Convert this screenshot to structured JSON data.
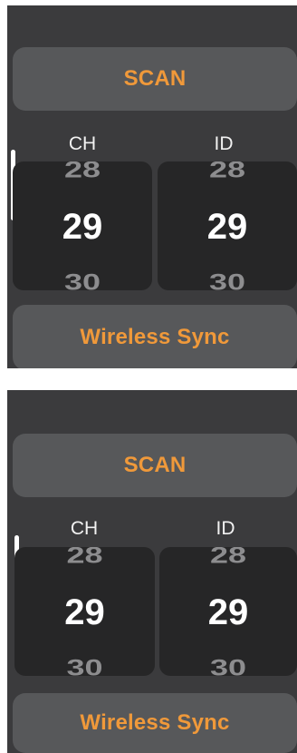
{
  "panels": [
    {
      "scan_label": "SCAN",
      "ch_label": "CH",
      "id_label": "ID",
      "ch": {
        "prev": "28",
        "current": "29",
        "next": "30"
      },
      "id": {
        "prev": "28",
        "current": "29",
        "next": "30"
      },
      "sync_label": "Wireless Sync"
    },
    {
      "scan_label": "SCAN",
      "ch_label": "CH",
      "id_label": "ID",
      "ch": {
        "prev": "28",
        "current": "29",
        "next": "30"
      },
      "id": {
        "prev": "28",
        "current": "29",
        "next": "30"
      },
      "sync_label": "Wireless Sync"
    }
  ],
  "colors": {
    "panel_bg": "#3b3b3d",
    "button_bg": "#57585a",
    "accent": "#f0993a",
    "picker_bg": "#262627"
  }
}
